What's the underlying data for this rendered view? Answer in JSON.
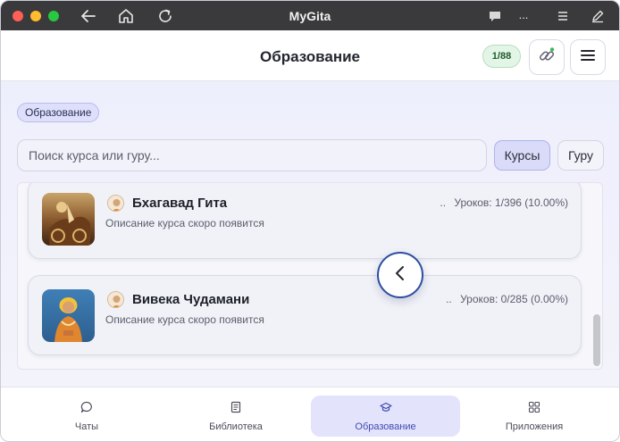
{
  "window": {
    "title": "MyGita",
    "titlebar_icons": [
      "back-arrow-icon",
      "home-icon",
      "reload-icon",
      "chat-bubble-icon",
      "more-icon",
      "list-icon",
      "pen-icon"
    ],
    "more_label": "..."
  },
  "header": {
    "title": "Образование",
    "progress": "1/88"
  },
  "filters": {
    "active_chip": "Образование",
    "search_placeholder": "Поиск курса или гуру...",
    "segments": [
      "Курсы",
      "Гуру"
    ],
    "selected_segment": "Курсы"
  },
  "courses": [
    {
      "title": "Бхагавад Гита",
      "description": "Описание курса скоро появится",
      "ellipsis": "..",
      "stats": "Уроков: 1/396 (10.00%)"
    },
    {
      "title": "Вивека Чудамани",
      "description": "Описание курса скоро появится",
      "ellipsis": "..",
      "stats": "Уроков: 0/285 (0.00%)"
    }
  ],
  "bottom_nav": [
    {
      "label": "Чаты",
      "icon": "chat-icon",
      "active": false
    },
    {
      "label": "Библиотека",
      "icon": "book-icon",
      "active": false
    },
    {
      "label": "Образование",
      "icon": "graduation-cap-icon",
      "active": true
    },
    {
      "label": "Приложения",
      "icon": "apps-grid-icon",
      "active": false
    }
  ],
  "colors": {
    "accent": "#3f4bb3",
    "fab_border": "#2d4ea0",
    "progress_bg": "#e3f5e6"
  }
}
